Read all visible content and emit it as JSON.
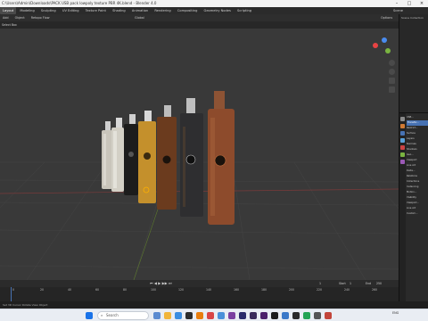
{
  "window": {
    "title": "C:\\Users\\Admin\\Downloads\\PACK USB pack lowpoly texture PBR 4K.blend - Blender 4.0"
  },
  "menubar": {
    "items": [
      "Layout",
      "Modeling",
      "Sculpting",
      "UV Editing",
      "Texture Paint",
      "Shading",
      "Animation",
      "Rendering",
      "Compositing",
      "Geometry Nodes",
      "Scripting"
    ],
    "scene_label": "Scene"
  },
  "toolbar": {
    "items": [
      "Add",
      "Object",
      "Retopo Flow"
    ],
    "transform_orientation": "Global",
    "options_label": "Options"
  },
  "optbar": {
    "select_box": "Select Box"
  },
  "outliner": {
    "header": "Scene Collection"
  },
  "properties": {
    "rows": [
      "USB...",
      "Transfor...",
      "Restrict...",
      "Surface",
      "Layers",
      "Normals",
      "Shadows",
      "Geo...",
      "Viewport",
      "Line Art",
      "Delta...",
      "Relations",
      "Collections",
      "Instancing",
      "Motion...",
      "Visibility",
      "Viewport...",
      "Line Art",
      "Custom..."
    ]
  },
  "timeline": {
    "frame_start_label": "Start",
    "frame_start": "1",
    "frame_end_label": "End",
    "frame_end": "250",
    "current_frame": "1",
    "ticks": [
      "0",
      "20",
      "40",
      "60",
      "80",
      "100",
      "120",
      "140",
      "160",
      "180",
      "200",
      "220",
      "240",
      "260"
    ]
  },
  "statusbar": {
    "left": "Set 3D Cursor  Rotate View  Object"
  },
  "taskbar": {
    "search_placeholder": "Search",
    "tray_lang": "ENG",
    "tray_time": "",
    "tray_date": ""
  },
  "usb_sticks": [
    {
      "color": "#c9c5bb",
      "cap": "#cfcfcf"
    },
    {
      "color": "#d3d0c6",
      "cap": "#d8d8d8"
    },
    {
      "color": "#1c1c1c",
      "cap": "#cfcfcf"
    },
    {
      "color": "#c4902c",
      "cap": "#d8d8d8"
    },
    {
      "color": "#6b3b1e",
      "cap": "#bdbdbd"
    },
    {
      "color": "#2e2e30",
      "cap": "#bfbfbf"
    },
    {
      "color": "#8d4b2c",
      "cap": "#8d5334"
    }
  ],
  "colors": {
    "accent": "#4772b3",
    "viewport_bg": "#393939",
    "grid_line": "#474747"
  }
}
